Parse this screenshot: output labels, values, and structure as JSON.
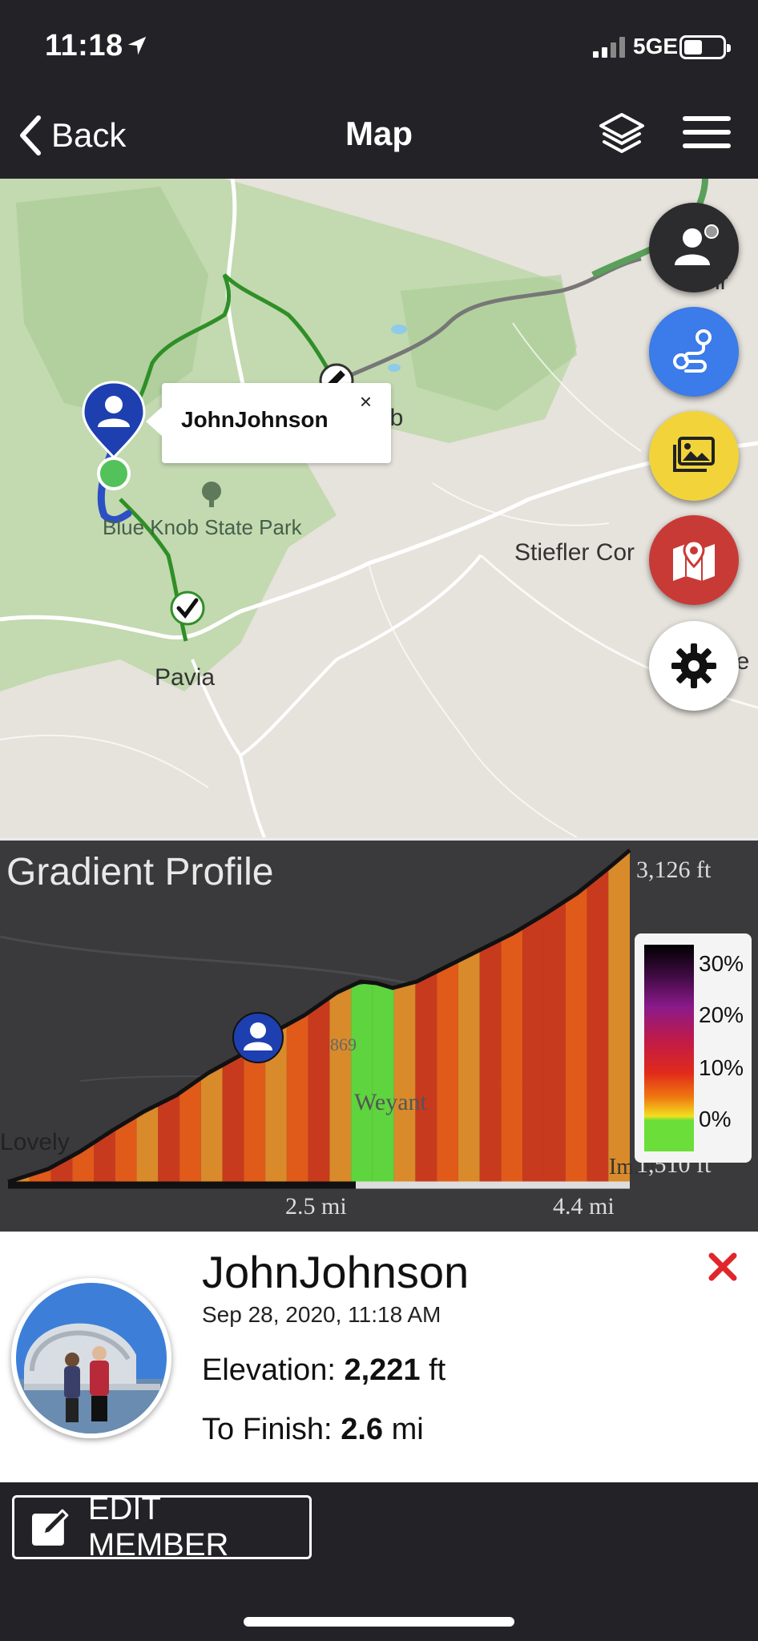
{
  "status_bar": {
    "time": "11:18",
    "network": "5GE"
  },
  "nav": {
    "back_label": "Back",
    "title": "Map"
  },
  "map": {
    "labels": {
      "park": "Blue Knob State Park",
      "town1": "Pavia",
      "town2": "Stiefler Cor",
      "partial1": "ob",
      "partial2": "nr",
      "partial3": "ue"
    },
    "popup": {
      "name": "JohnJohnson",
      "close": "×"
    },
    "fab_buttons": [
      "member-button",
      "route-button",
      "gallery-button",
      "map-pin-button",
      "settings-button"
    ]
  },
  "profile": {
    "title": "Gradient Profile",
    "elev_max": "3,126 ft",
    "elev_min": "1,510 ft",
    "dist_current": "2.5 mi",
    "dist_total": "4.4 mi",
    "map_label": "Lovely",
    "bg_labels": {
      "road": "869",
      "town": "Weyant",
      "partial": "Im.el"
    },
    "legend": [
      "30%",
      "20%",
      "10%",
      "0%"
    ]
  },
  "chart_data": {
    "type": "area",
    "title": "Gradient Profile",
    "x_unit": "mi",
    "y_unit": "ft",
    "ylim": [
      1510,
      3126
    ],
    "xlim": [
      0,
      4.4
    ],
    "x_ticks": [
      "2.5 mi",
      "4.4 mi"
    ],
    "progress_fraction": 0.57,
    "legend": [
      "30%",
      "20%",
      "10%",
      "0%"
    ],
    "colors": {
      "steep": "#c83a1e",
      "moderate": "#e05a1a",
      "mild": "#d98a2a",
      "flat": "#5ed43e"
    }
  },
  "member": {
    "name": "JohnJohnson",
    "date": "Sep 28, 2020, 11:18 AM",
    "elevation_label": "Elevation:",
    "elevation_value": "2,221",
    "elevation_unit": "ft",
    "finish_label": "To Finish:",
    "finish_value": "2.6",
    "finish_unit": "mi"
  },
  "bottom": {
    "edit_label": "EDIT MEMBER"
  },
  "colors": {
    "accent_red": "#e0262a",
    "fab_blue": "#3b7bea",
    "fab_yellow": "#f2d43a",
    "fab_red": "#c83a36",
    "fab_dark": "#2c2c2e"
  }
}
